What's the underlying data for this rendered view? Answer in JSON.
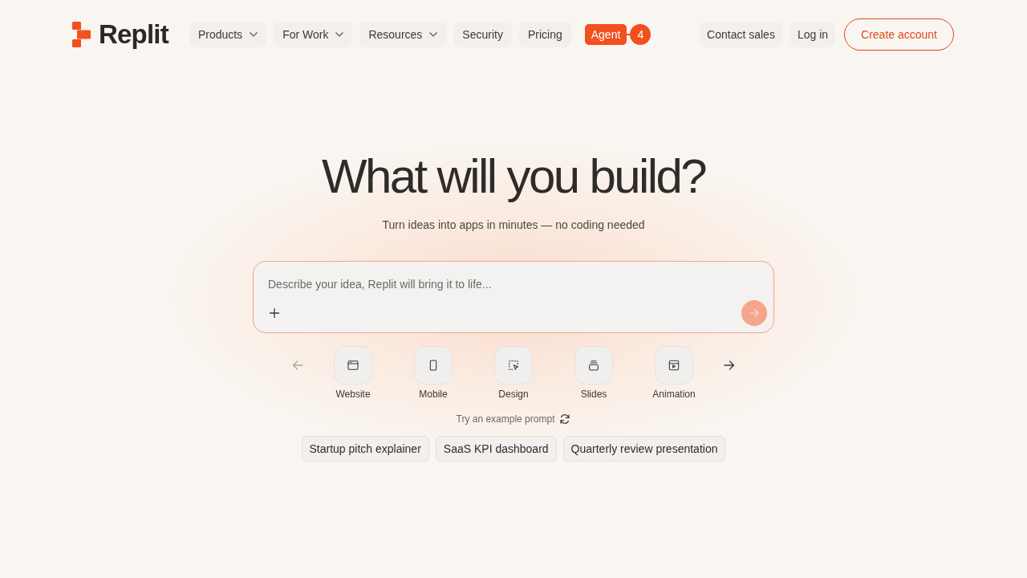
{
  "header": {
    "brand": "Replit",
    "nav": [
      {
        "label": "Products",
        "kind": "dropdown"
      },
      {
        "label": "For Work",
        "kind": "dropdown"
      },
      {
        "label": "Resources",
        "kind": "dropdown"
      },
      {
        "label": "Security",
        "kind": "link"
      },
      {
        "label": "Pricing",
        "kind": "link"
      },
      {
        "label": "Agent",
        "kind": "highlight",
        "badge": "4"
      }
    ],
    "actions": [
      {
        "label": "Contact sales",
        "kind": "link"
      },
      {
        "label": "Log in",
        "kind": "link"
      },
      {
        "label": "Create account",
        "kind": "outline"
      }
    ]
  },
  "hero": {
    "title": "What will you build?",
    "subtitle": "Turn ideas into apps in minutes — no coding needed"
  },
  "prompt": {
    "placeholder": "Describe your idea, Replit will bring it to life..."
  },
  "carousel": {
    "prev_disabled": true,
    "next_disabled": false,
    "categories": [
      {
        "label": "Website"
      },
      {
        "label": "Mobile"
      },
      {
        "label": "Design"
      },
      {
        "label": "Slides"
      },
      {
        "label": "Animation"
      }
    ]
  },
  "examples": {
    "label": "Try an example prompt",
    "prompts": [
      "Startup pitch explainer",
      "SaaS KPI dashboard",
      "Quarterly review presentation"
    ]
  }
}
